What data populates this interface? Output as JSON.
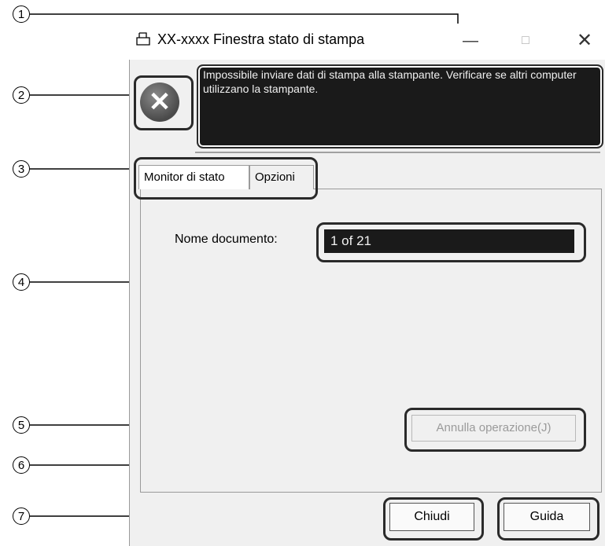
{
  "window": {
    "title": "XX-xxxx Finestra stato di stampa",
    "minimize_glyph": "—",
    "maximize_glyph": "□",
    "close_glyph": "✕"
  },
  "status": {
    "icon": "error-x-icon",
    "error_glyph": "✕",
    "message": "Impossibile inviare dati di stampa alla stampante. Verificare se altri computer utilizzano la stampante."
  },
  "tabs": [
    {
      "label": "Monitor di stato",
      "selected": true
    },
    {
      "label": "Opzioni",
      "selected": false
    }
  ],
  "document": {
    "label": "Nome documento:",
    "value": "1 of 21"
  },
  "buttons": {
    "cancel": "Annulla operazione(J)",
    "close": "Chiudi",
    "help": "Guida"
  },
  "callouts": [
    "1",
    "2",
    "3",
    "4",
    "5",
    "6",
    "7"
  ]
}
